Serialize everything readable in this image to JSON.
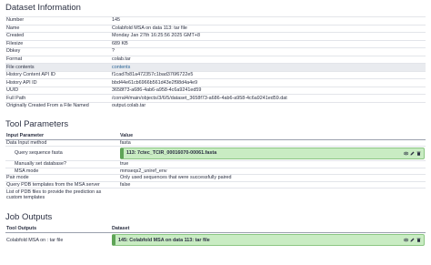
{
  "dataset_info": {
    "heading": "Dataset Information",
    "rows": [
      {
        "k": "Number",
        "v": "145"
      },
      {
        "k": "Name",
        "v": "Colabfold MSA on data 113: tar file"
      },
      {
        "k": "Created",
        "v": "Monday Jan 27th 16:25:56 2025 GMT+8"
      },
      {
        "k": "Filesize",
        "v": "689 KB"
      },
      {
        "k": "Dbkey",
        "v": "?"
      },
      {
        "k": "Format",
        "v": "colab.tar"
      },
      {
        "k": "File contents",
        "v": "contents"
      },
      {
        "k": "History Content API ID",
        "v": "f1cad7b81a472357c1bad376f6722e5"
      },
      {
        "k": "History API ID",
        "v": "bbd44e61cb6966b561d43e2f98d4a4e9"
      },
      {
        "k": "UUID",
        "v": "3658f73-a686-4ab6-a958-4c6a9241ed59"
      },
      {
        "k": "Full Path",
        "v": "/corral4/main/objects/3/6/5/dataset_3658f73-a686-4ab6-a958-4c6a9241ed59.dat"
      },
      {
        "k": "Originally Created From a File Named",
        "v": "output.colab.tar"
      }
    ]
  },
  "tool_params": {
    "heading": "Tool Parameters",
    "col_param": "Input Parameter",
    "col_value": "Value",
    "data_input_method": {
      "k": "Data Input method",
      "v": "fasta"
    },
    "query_seq": {
      "k": "Query sequence fasta",
      "v": "113: 7ctec_TCIR_00016070-00061.fasta"
    },
    "manual_db": {
      "k": "Manually set database?",
      "v": "true"
    },
    "msa_mode": {
      "k": "MSA mode",
      "v": "mmseqs2_uniref_env"
    },
    "pair_mode": {
      "k": "Pair mode",
      "v": "Only used sequences that were successfully paired"
    },
    "query_pdb": {
      "k": "Query PDB templates from the MSA server",
      "v": "false"
    },
    "list_pdb": {
      "k": "List of PDB files to provide the prediction as custom templates",
      "v": ""
    }
  },
  "job_outputs": {
    "heading": "Job Outputs",
    "col_tool": "Tool Outputs",
    "col_dataset": "Dataset",
    "row": {
      "k": "Colabfold MSA on : tar file",
      "v": "145: Colabfold MSA on data 113: tar file"
    }
  },
  "colors": {
    "link": "#2a6496",
    "ok_bg": "#c9ecc3",
    "ok_border": "#5ea457"
  }
}
